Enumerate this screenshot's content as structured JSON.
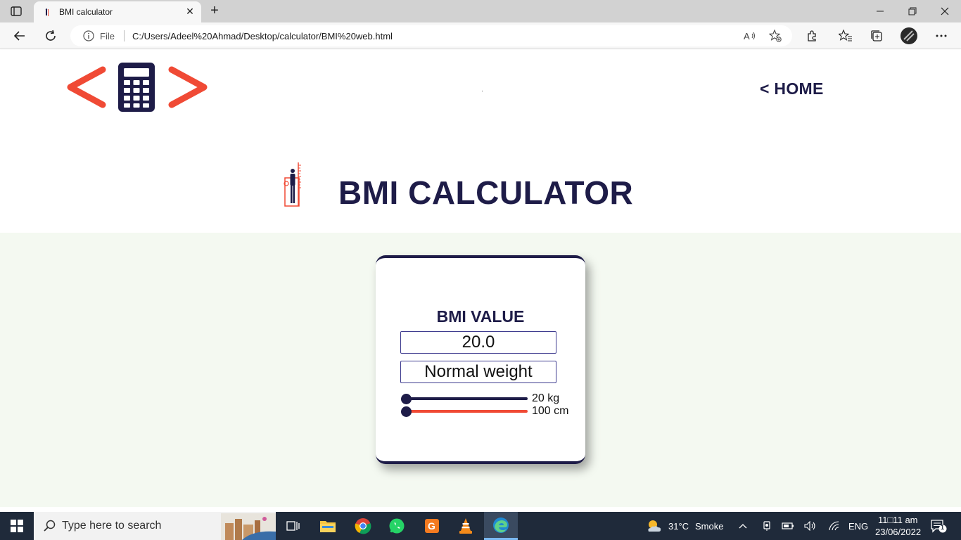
{
  "browser": {
    "tab_title": "BMI calculator",
    "tab_close": "✕",
    "new_tab": "+",
    "address_prefix": "File",
    "url": "C:/Users/Adeel%20Ahmad/Desktop/calculator/BMI%20web.html"
  },
  "header": {
    "home_label": "< HOME"
  },
  "page": {
    "title": "BMI CALCULATOR"
  },
  "card": {
    "title": "BMI VALUE",
    "bmi_value": "20.0",
    "category": "Normal weight",
    "weight_label": "20 kg",
    "height_label": "100 cm",
    "weight_slider_position": 0,
    "height_slider_position": 0
  },
  "colors": {
    "navy": "#1e1c48",
    "accent_red": "#f04a35",
    "content_bg": "#f4f9f1"
  },
  "taskbar": {
    "search_placeholder": "Type here to search",
    "weather_temp": "31°C",
    "weather_text": "Smoke",
    "language": "ENG",
    "time": "11□11 am",
    "date": "23/06/2022",
    "notification_count": "1"
  }
}
